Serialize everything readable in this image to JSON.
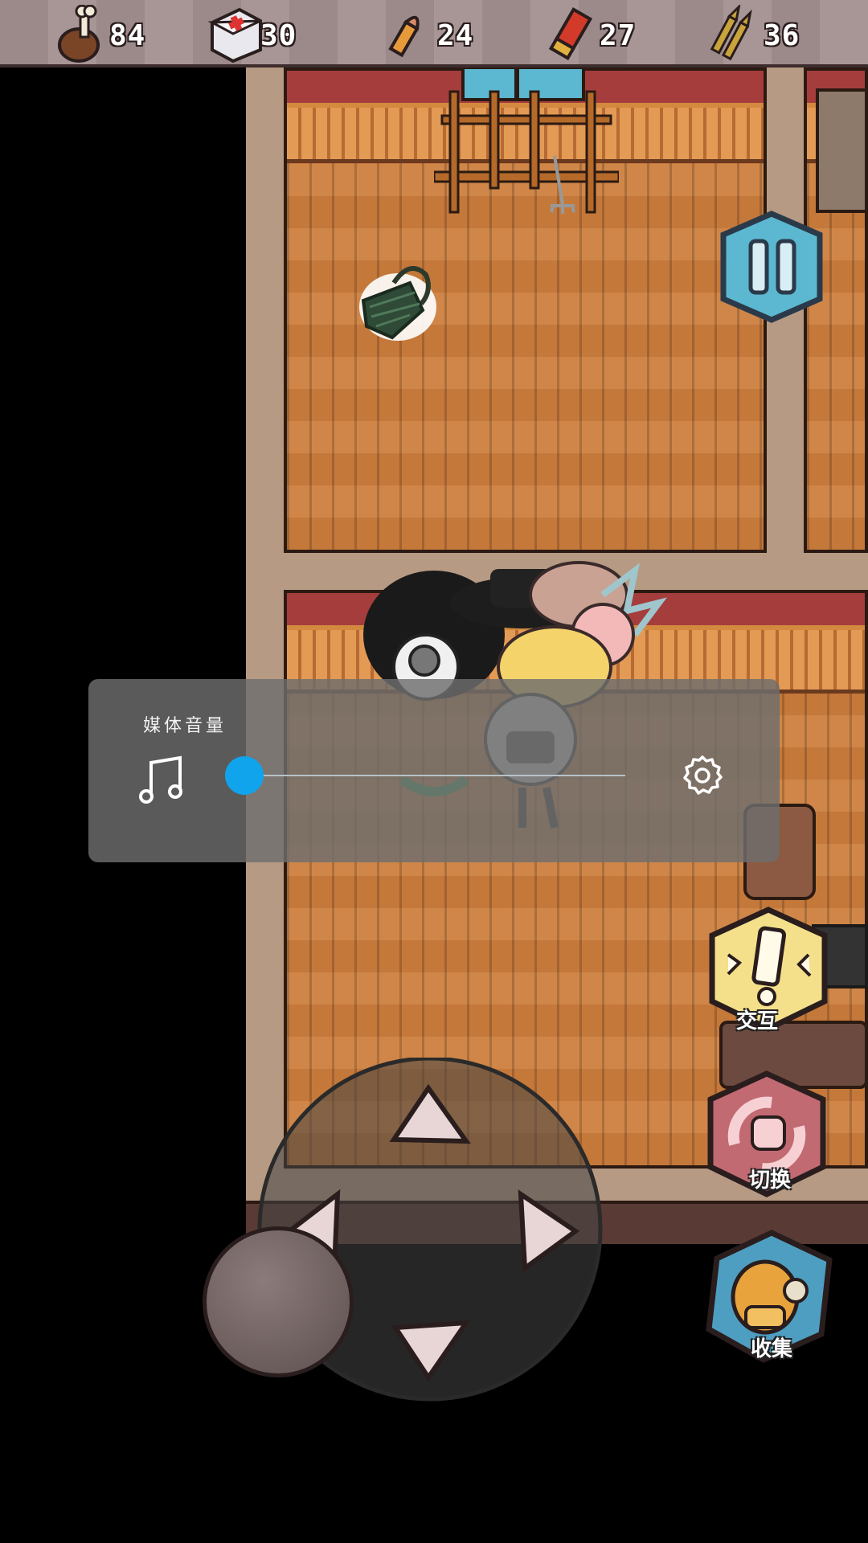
{
  "resources": [
    {
      "name": "food",
      "icon": "drumstick-icon",
      "value": "84"
    },
    {
      "name": "medkit",
      "icon": "first-aid-kit-icon",
      "value": "30"
    },
    {
      "name": "pistol-ammo",
      "icon": "bullet-icon",
      "value": "24"
    },
    {
      "name": "shotgun-ammo",
      "icon": "shotgun-shell-icon",
      "value": "27"
    },
    {
      "name": "rifle-ammo",
      "icon": "rifle-bullets-icon",
      "value": "36"
    }
  ],
  "volume_overlay": {
    "title": "媒体音量",
    "level": 0.0,
    "music_icon": "music-note-icon",
    "settings_icon": "gear-icon",
    "accent_color": "#10a4ec"
  },
  "actions": {
    "interact_label": "交互",
    "switch_label": "切换",
    "collect_label": "收集"
  },
  "colors": {
    "floor": "#c4783a",
    "wall": "#b79a83",
    "topbar": "#9c8a8a"
  }
}
